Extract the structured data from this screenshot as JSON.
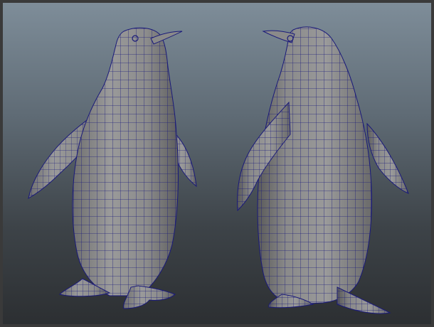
{
  "viewport": {
    "name": "3d-viewport",
    "background": {
      "top": "#7e8d99",
      "bottom": "#2c2f32"
    },
    "mesh": {
      "fill": "#8f8f8f",
      "shade": "#6a6a6a",
      "wireframe": "#1a1a7a"
    },
    "models": [
      {
        "name": "penguin-model-left",
        "view": "front-right"
      },
      {
        "name": "penguin-model-right",
        "view": "front-left"
      }
    ]
  }
}
